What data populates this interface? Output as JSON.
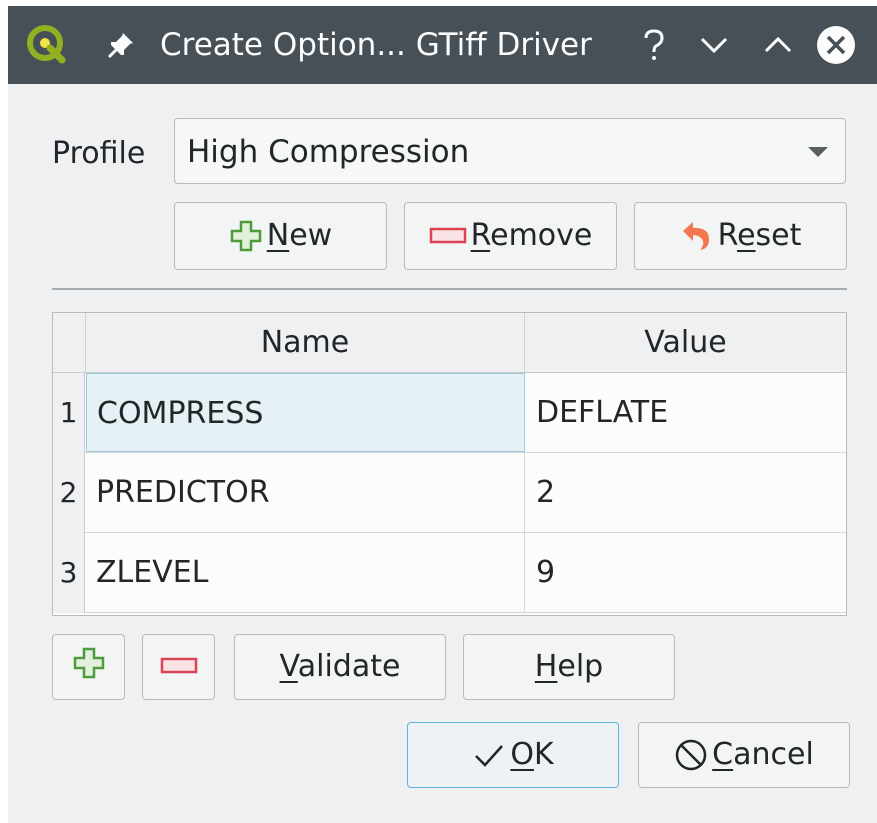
{
  "window": {
    "title": "Create Option... GTiff Driver"
  },
  "profile": {
    "label": "Profile",
    "selected": "High Compression"
  },
  "profile_buttons": {
    "new_mnemonic": "N",
    "new_rest": "ew",
    "remove_mnemonic": "R",
    "remove_rest": "emove",
    "reset_first": "R",
    "reset_mnemonic": "e",
    "reset_rest": "set"
  },
  "table": {
    "headers": [
      "Name",
      "Value"
    ],
    "rows": [
      {
        "num": "1",
        "name": "COMPRESS",
        "value": "DEFLATE"
      },
      {
        "num": "2",
        "name": "PREDICTOR",
        "value": "2"
      },
      {
        "num": "3",
        "name": "ZLEVEL",
        "value": "9"
      }
    ],
    "selected_row": 1
  },
  "bottom_buttons": {
    "validate_mnemonic": "V",
    "validate_rest": "alidate",
    "help_mnemonic": "H",
    "help_rest": "elp",
    "ok_mnemonic": "O",
    "ok_rest": "K",
    "cancel_mnemonic": "C",
    "cancel_rest": "ancel"
  },
  "icons": {
    "app": "qgis-logo-icon",
    "pin": "pin-icon",
    "help": "help-icon",
    "minimize": "minimize-icon",
    "maximize": "maximize-icon",
    "close": "close-icon",
    "add": "plus-icon",
    "remove": "minus-icon",
    "reset": "undo-icon",
    "ok": "checkmark-icon",
    "cancel": "cancel-icon"
  },
  "colors": {
    "titlebar": "#475057",
    "plus_green": "#4e9a3c",
    "minus_red": "#da4453",
    "reset_orange": "#f47750",
    "focus_blue": "#5fb3dc"
  }
}
